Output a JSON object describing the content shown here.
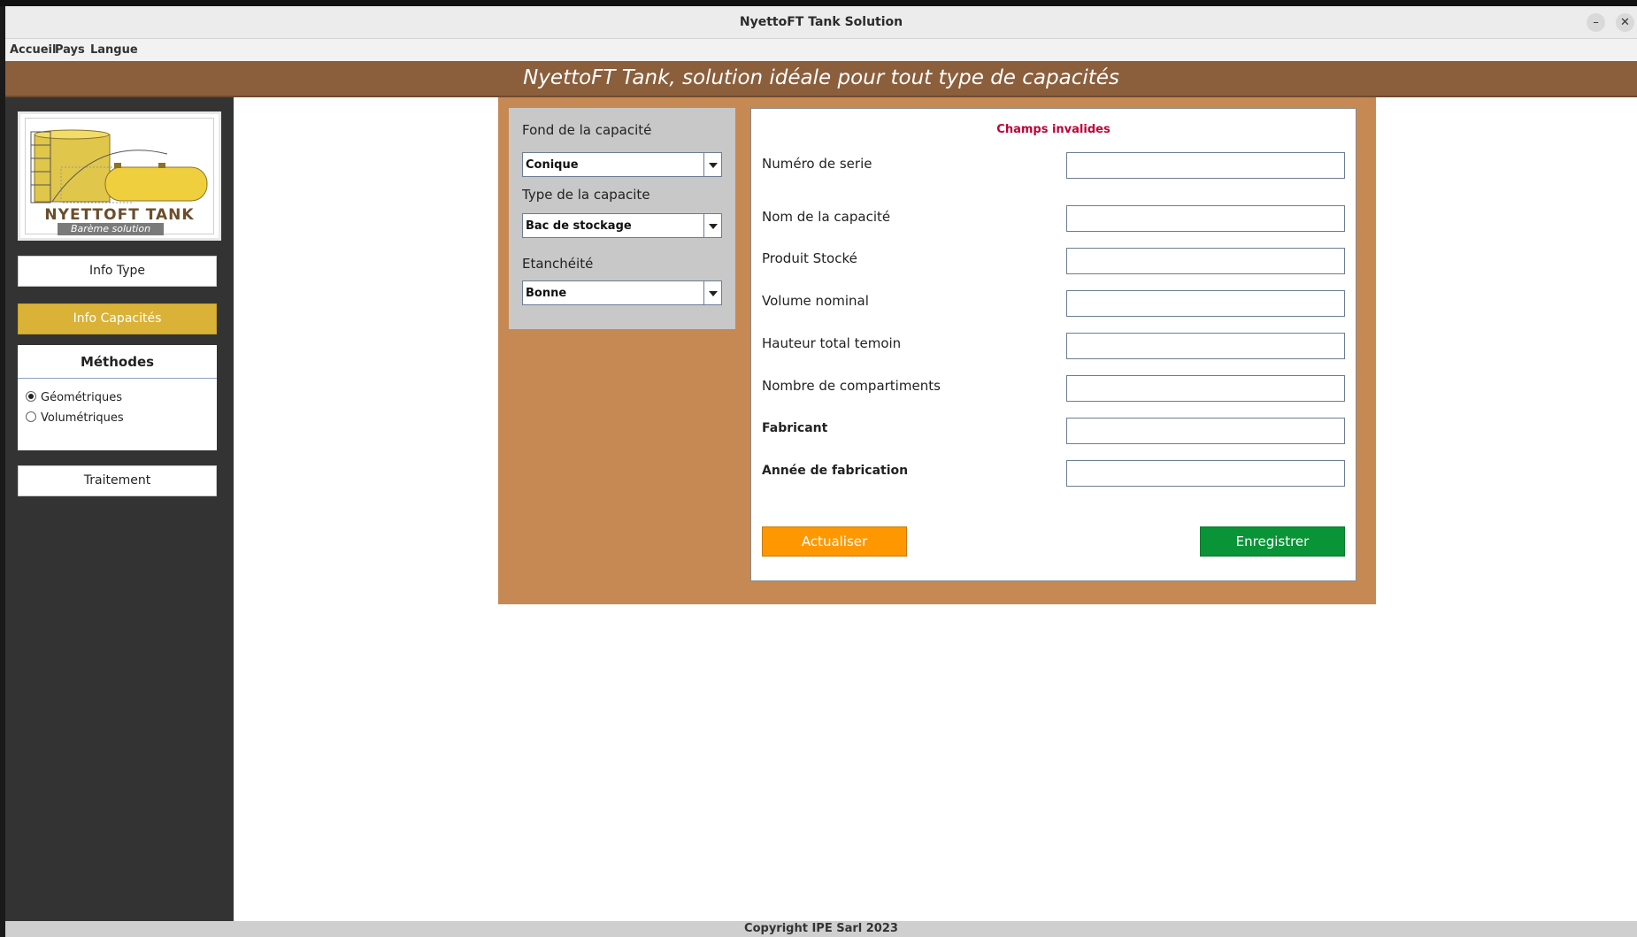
{
  "window": {
    "title": "NyettoFT Tank Solution",
    "minimize_label": "–",
    "close_label": "✕"
  },
  "menubar": {
    "items": [
      "Accueil",
      "Pays",
      "Langue"
    ]
  },
  "banner": {
    "text": "NyettoFT Tank, solution idéale pour tout type de capacités"
  },
  "sidebar": {
    "logo": {
      "title": "NYETTOFT TANK",
      "subtitle": "Barème solution"
    },
    "info_type_label": "Info Type",
    "info_capacites_label": "Info Capacités",
    "methods": {
      "title": "Méthodes",
      "options": [
        {
          "label": "Géométriques",
          "checked": true
        },
        {
          "label": "Volumétriques",
          "checked": false
        }
      ]
    },
    "traitement_label": "Traitement"
  },
  "left_form": {
    "fond_label": "Fond de la capacité",
    "fond_value": "Conique",
    "type_label": "Type de la capacite",
    "type_value": "Bac de stockage",
    "etancheite_label": "Etanchéité",
    "etancheite_value": "Bonne"
  },
  "form": {
    "error": "Champs invalides",
    "fields": [
      {
        "label": "Numéro de serie",
        "value": ""
      },
      {
        "label": "Nom de la capacité",
        "value": ""
      },
      {
        "label": "Produit Stocké",
        "value": ""
      },
      {
        "label": "Volume nominal",
        "value": ""
      },
      {
        "label": "Hauteur total temoin",
        "value": ""
      },
      {
        "label": "Nombre de compartiments",
        "value": ""
      },
      {
        "label": "Fabricant",
        "value": ""
      },
      {
        "label": "Année de fabrication",
        "value": ""
      }
    ],
    "update_label": "Actualiser",
    "save_label": "Enregistrer"
  },
  "footer": {
    "text": "Copyright IPE Sarl 2023"
  },
  "colors": {
    "banner": "#8b5e3c",
    "sidebar": "#333333",
    "active_button": "#dab237",
    "panel": "#c68954",
    "error": "#c00035",
    "update_button": "#ff9800",
    "save_button": "#0a9438"
  }
}
